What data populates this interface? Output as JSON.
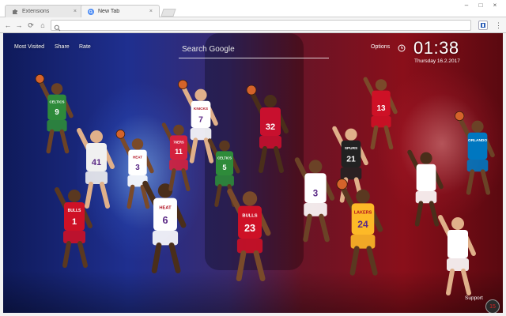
{
  "browser": {
    "tabs": [
      {
        "title": "Extensions",
        "icon": "puzzle-icon",
        "close_glyph": "×"
      },
      {
        "title": "New Tab",
        "icon": "chrome-search-icon",
        "close_glyph": "×"
      }
    ],
    "window_controls": {
      "minimize": "–",
      "maximize": "□",
      "close": "×"
    },
    "nav": {
      "back": "←",
      "forward": "→",
      "reload": "⟳",
      "home": "⌂"
    },
    "address_value": "",
    "menu_glyph": "⋮"
  },
  "page": {
    "nav_links": [
      {
        "label": "Most Visited"
      },
      {
        "label": "Share"
      },
      {
        "label": "Rate"
      }
    ],
    "search_placeholder": "Search Google",
    "options_label": "Options",
    "clock_time": "01:38",
    "date": "Thursday  16.2.2017",
    "support_label": "Support",
    "badge_text": "15",
    "colors": {
      "background_left": "#1f2f8f",
      "background_right": "#8a0f1a",
      "text": "#ffffff"
    }
  },
  "players": [
    {
      "jersey": "9",
      "team": "CELTICS",
      "color": "#2e8b3a"
    },
    {
      "jersey": "41",
      "team": "",
      "color": "#f0f0f0"
    },
    {
      "jersey": "1",
      "team": "BULLS",
      "color": "#ce1126"
    },
    {
      "jersey": "3",
      "team": "HEAT",
      "color": "#ffffff"
    },
    {
      "jersey": "6",
      "team": "HEAT",
      "color": "#ffffff"
    },
    {
      "jersey": "11",
      "team": "76ERS",
      "color": "#d4213d"
    },
    {
      "jersey": "7",
      "team": "KNICKS",
      "color": "#ffffff"
    },
    {
      "jersey": "5",
      "team": "CELTICS",
      "color": "#2e8b3a"
    },
    {
      "jersey": "23",
      "team": "BULLS",
      "color": "#ce1126"
    },
    {
      "jersey": "32",
      "team": "",
      "color": "#c8102e"
    },
    {
      "jersey": "3",
      "team": "",
      "color": "#ffffff"
    },
    {
      "jersey": "21",
      "team": "SPURS",
      "color": "#222222"
    },
    {
      "jersey": "24",
      "team": "LAKERS",
      "color": "#fdb927"
    },
    {
      "jersey": "13",
      "team": "",
      "color": "#ce1126"
    },
    {
      "jersey": "",
      "team": "",
      "color": "#ffffff"
    },
    {
      "jersey": "",
      "team": "ORLANDO",
      "color": "#0077c0"
    },
    {
      "jersey": "",
      "team": "",
      "color": "#ffffff"
    }
  ]
}
